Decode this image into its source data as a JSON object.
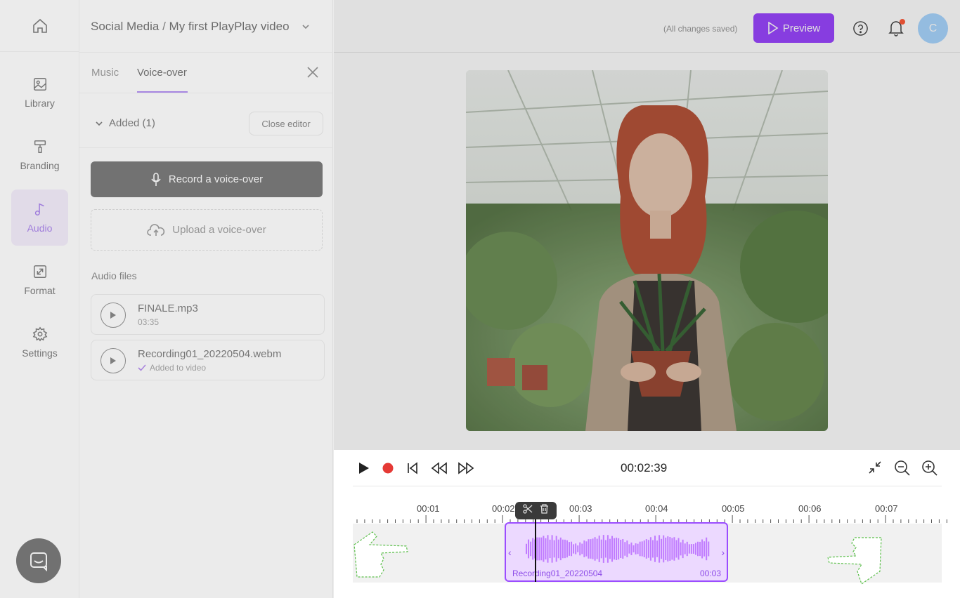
{
  "rail": {
    "items": [
      {
        "label": "Library",
        "icon": "image-icon"
      },
      {
        "label": "Branding",
        "icon": "paint-roller-icon"
      },
      {
        "label": "Audio",
        "icon": "music-note-icon",
        "active": true
      },
      {
        "label": "Format",
        "icon": "resize-icon"
      },
      {
        "label": "Settings",
        "icon": "gear-icon"
      }
    ]
  },
  "project": {
    "folder": "Social Media",
    "separator": "/",
    "name": "My first PlayPlay video"
  },
  "panel": {
    "tabs": [
      {
        "label": "Music"
      },
      {
        "label": "Voice-over",
        "active": true
      }
    ],
    "added_label": "Added (1)",
    "close_editor_label": "Close editor",
    "record_label": "Record a voice-over",
    "upload_label": "Upload a voice-over",
    "files_heading": "Audio files",
    "files": [
      {
        "name": "FINALE.mp3",
        "sub": "03:35"
      },
      {
        "name": "Recording01_20220504.webm",
        "sub": "Added to video"
      }
    ]
  },
  "topbar": {
    "saved_status": "(All changes saved)",
    "preview_label": "Preview",
    "avatar_initial": "C"
  },
  "player": {
    "timecode": "00:02:39",
    "ticks": [
      "00:01",
      "00:02",
      "00:03",
      "00:04",
      "00:05",
      "00:06",
      "00:07"
    ],
    "clip": {
      "name": "Recording01_20220504",
      "duration": "00:03"
    }
  },
  "colors": {
    "accent": "#9a46ff",
    "record": "#e53935"
  }
}
